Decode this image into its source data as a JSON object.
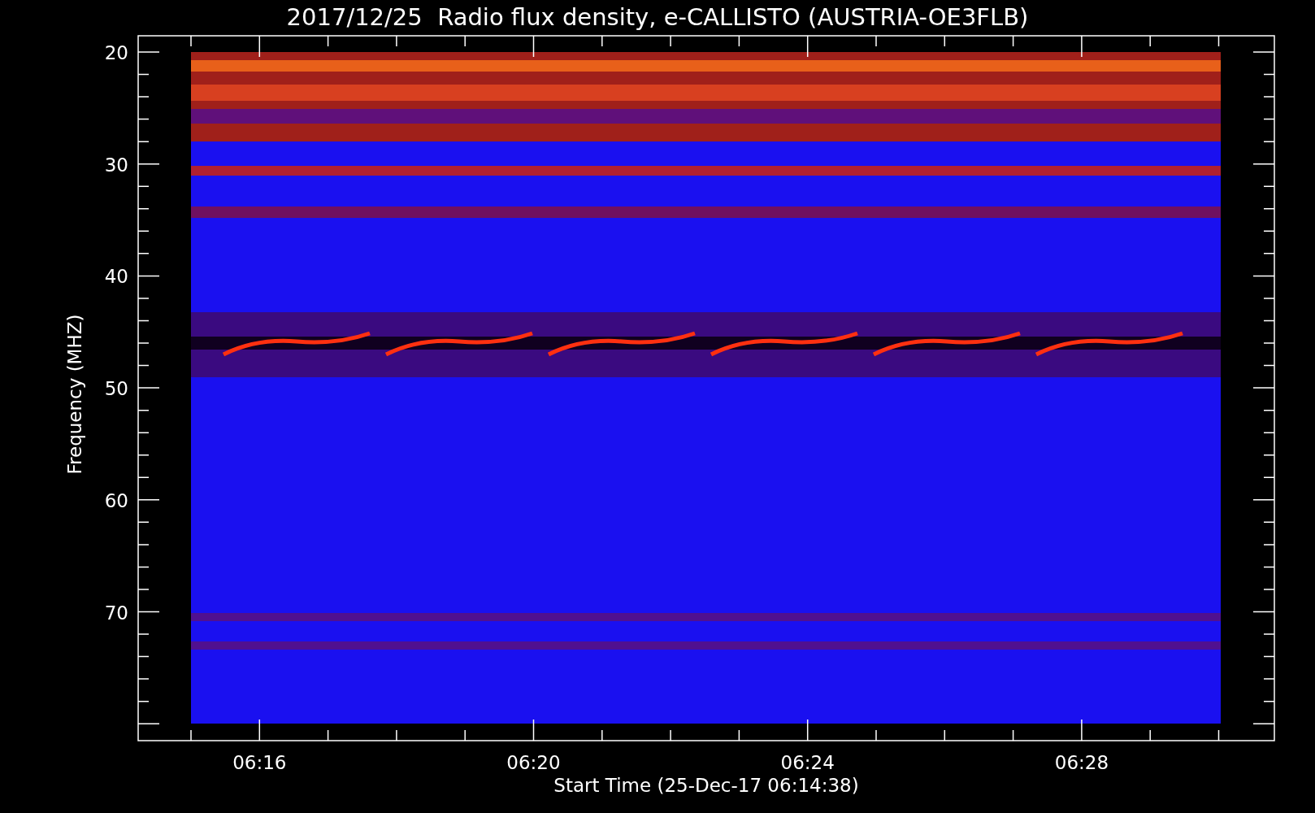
{
  "title": "2017/12/25  Radio flux density, e-CALLISTO (AUSTRIA-OE3FLB)",
  "y_axis": {
    "label": "Frequency (MHZ)",
    "ticks": [
      "20",
      "30",
      "40",
      "50",
      "60",
      "70"
    ]
  },
  "x_axis": {
    "label": "Start Time (25-Dec-17 06:14:38)",
    "ticks": [
      "06:16",
      "06:20",
      "06:24",
      "06:28"
    ]
  }
}
